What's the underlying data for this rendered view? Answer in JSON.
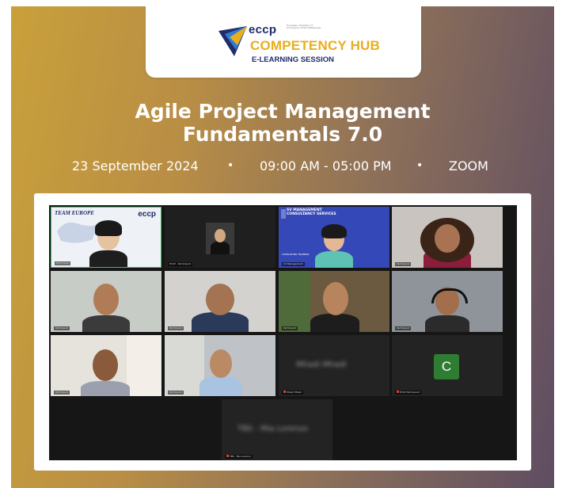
{
  "logo": {
    "brand": "eccp",
    "tagline": "European Chamber of Commerce of the Philippines",
    "hub": "COMPETENCY HUB",
    "subtitle": "E-LEARNING SESSION"
  },
  "event": {
    "title_line1": "Agile Project Management",
    "title_line2": "Fundamentals 7.0",
    "date": "23 September 2024",
    "separator": "•",
    "time": "09:00 AM - 05:00 PM",
    "venue": "ZOOM"
  },
  "meeting": {
    "tiles": {
      "t1": {
        "header_left": "TEAM EUROPE",
        "header_right": "eccp",
        "name": "ECCP Host"
      },
      "t2": {
        "name": "ECCP - Participant"
      },
      "t3": {
        "banner": "SV MANAGEMENT CONSULTANCY SERVICES",
        "banner_sub": "CONSULTING TRAINING",
        "name": "SV Management"
      },
      "t4": {
        "name": "Participant"
      },
      "t5": {
        "name": "Participant"
      },
      "t6": {
        "name": "Participant"
      },
      "t7": {
        "name": "Participant"
      },
      "t8": {
        "name": "Participant"
      },
      "t9": {
        "name": "Participant"
      },
      "t10": {
        "name": "Participant"
      },
      "t11": {
        "display_name": "Mhadi Mhadi",
        "name": "Mhadi Mhadi"
      },
      "t12": {
        "avatar_letter": "C",
        "name": "ECCP Participant"
      },
      "t13": {
        "display_name": "TBS - Mia Lorenzo",
        "name": "TBS - Mia Lorenzo"
      }
    }
  },
  "colors": {
    "gradient_left": "#c9a03a",
    "gradient_right": "#5f4d62",
    "brand_navy": "#1f2d6b",
    "brand_gold": "#e8ae1d",
    "zoom_bg": "#161616",
    "avatar_green": "#2e7d32"
  }
}
